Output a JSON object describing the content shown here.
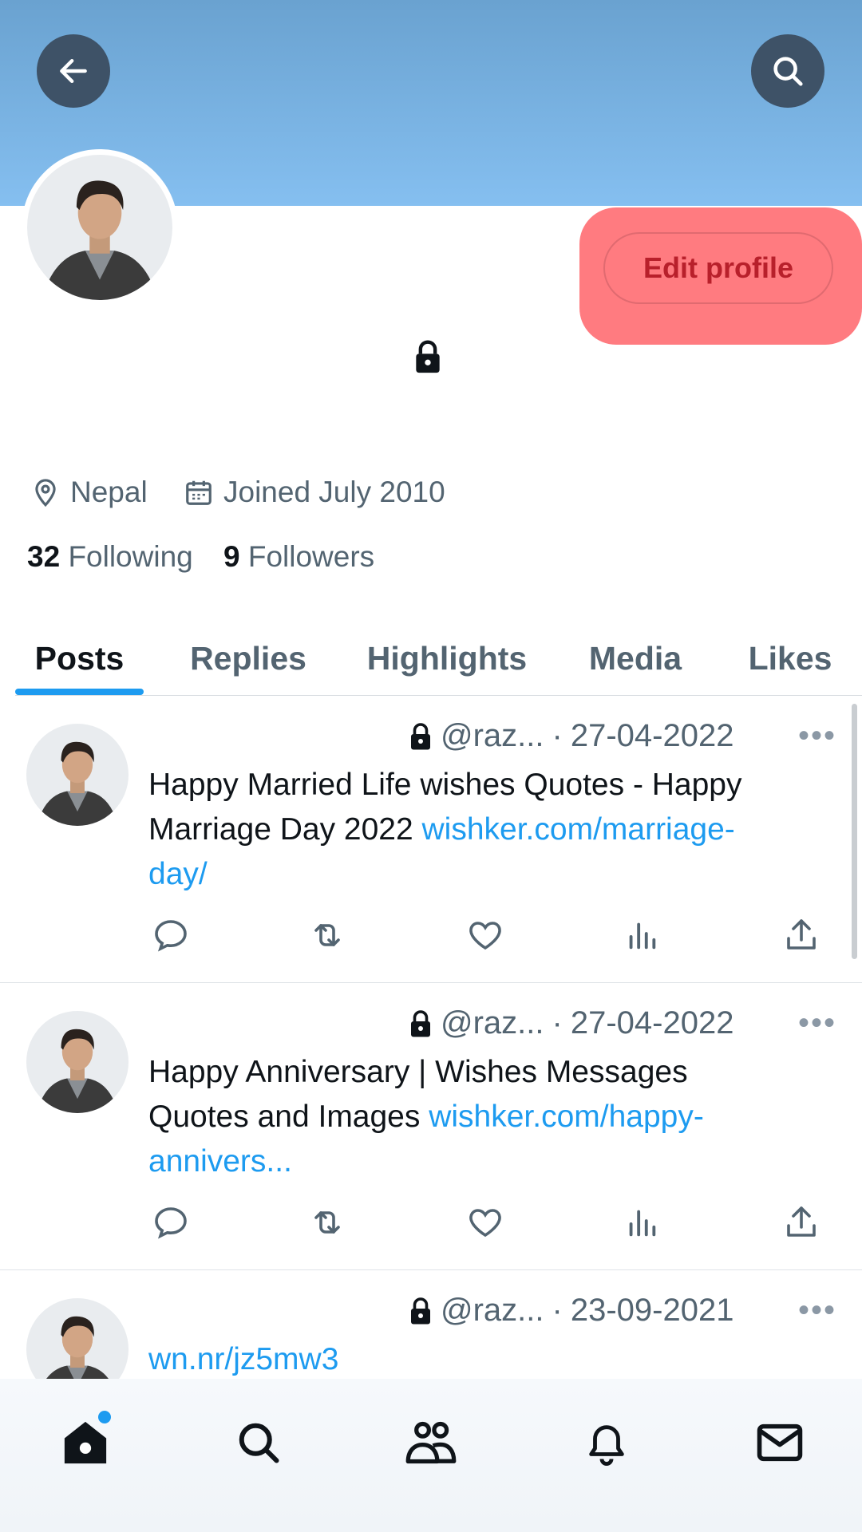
{
  "header": {
    "back_icon": "arrow-left-icon",
    "search_icon": "search-icon"
  },
  "profile": {
    "edit_label": "Edit profile",
    "location": "Nepal",
    "joined": "Joined July 2010",
    "following_count": "32",
    "following_label": "Following",
    "followers_count": "9",
    "followers_label": "Followers"
  },
  "tabs": [
    {
      "label": "Posts",
      "active": true
    },
    {
      "label": "Replies",
      "active": false
    },
    {
      "label": "Highlights",
      "active": false
    },
    {
      "label": "Media",
      "active": false
    },
    {
      "label": "Likes",
      "active": false
    }
  ],
  "posts": [
    {
      "handle": "@raz...",
      "sep": "·",
      "date": "27-04-2022",
      "text_line1": "Happy Married Life wishes Quotes - Happy",
      "text_line2": "Marriage Day 2022 ",
      "link_part1": "wishker.com/marriage-",
      "link_part2": "day/"
    },
    {
      "handle": "@raz...",
      "sep": "·",
      "date": "27-04-2022",
      "text_line1": "Happy Anniversary | Wishes Messages",
      "text_line2": "Quotes and Images ",
      "link_part1": "wishker.com/happy-",
      "link_part2": "annivers..."
    },
    {
      "handle": "@raz...",
      "sep": "·",
      "date": "23-09-2021",
      "link_part1": "wn.nr/jz5mw3"
    }
  ],
  "more_label": "•••",
  "colors": {
    "accent": "#1d9bf0",
    "banner_top": "#6aa2d0",
    "edit_highlight": "#ff7b80",
    "edit_text": "#b8202b"
  }
}
